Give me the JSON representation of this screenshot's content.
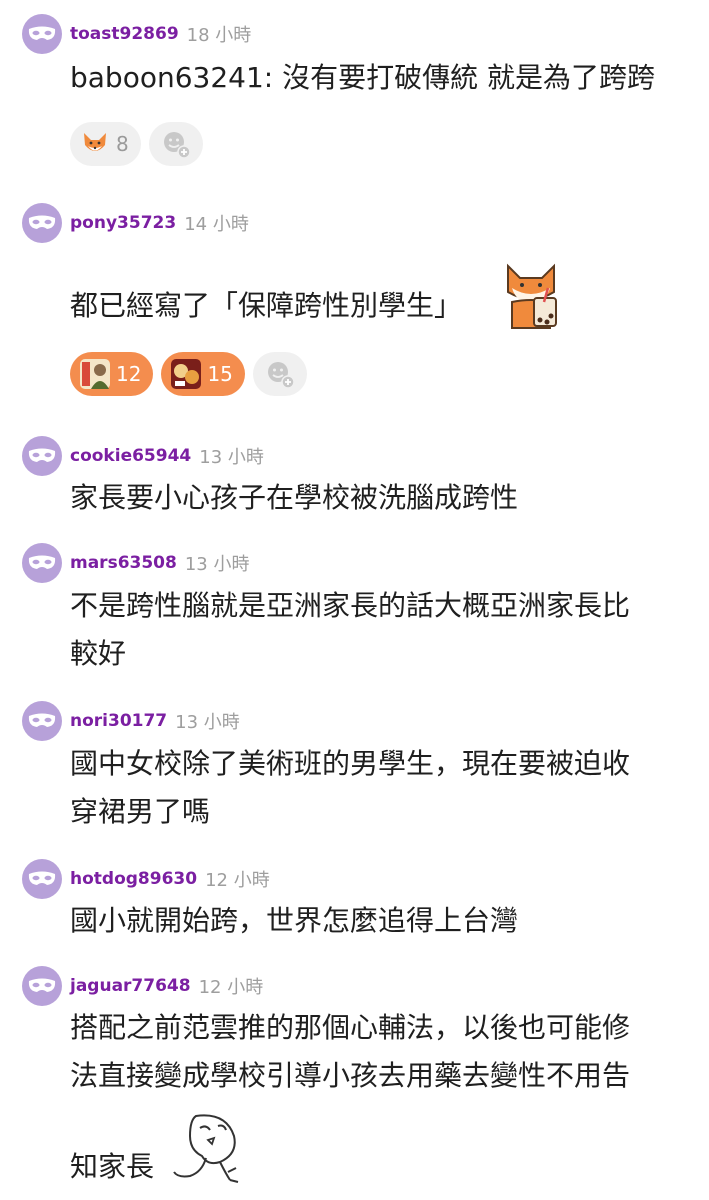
{
  "comments": [
    {
      "username": "toast92869",
      "time": "18 小時",
      "text_lines": [
        "baboon63241: 沒有要打破傳統 就是為了跨跨"
      ],
      "reactions": [
        {
          "icon": "fox-emoji-icon",
          "count": "8",
          "style": "grey"
        }
      ]
    },
    {
      "username": "pony35723",
      "time": "14 小時",
      "text_lines": [
        "都已經寫了「保障跨性別學生」"
      ],
      "sticker": "fox-drinking-bubble-tea-sticker",
      "reactions": [
        {
          "icon": "portrait-sticker-icon",
          "count": "12",
          "style": "orange"
        },
        {
          "icon": "food-sticker-icon",
          "count": "15",
          "style": "orange"
        }
      ]
    },
    {
      "username": "cookie65944",
      "time": "13 小時",
      "text_lines": [
        "家長要小心孩子在學校被洗腦成跨性"
      ]
    },
    {
      "username": "mars63508",
      "time": "13 小時",
      "text_lines": [
        "不是跨性腦就是亞洲家長的話大概亞洲家長比",
        "較好"
      ]
    },
    {
      "username": "nori30177",
      "time": "13 小時",
      "text_lines": [
        "國中女校除了美術班的男學生，現在要被迫收",
        "穿裙男了嗎"
      ]
    },
    {
      "username": "hotdog89630",
      "time": "12 小時",
      "text_lines": [
        "國小就開始跨，世界怎麼追得上台灣"
      ]
    },
    {
      "username": "jaguar77648",
      "time": "12 小時",
      "text_lines": [
        "搭配之前范雲推的那個心輔法，以後也可能修",
        "法直接變成學校引導小孩去用藥去變性不用告",
        "知家長"
      ],
      "sticker": "alien-doodle-sticker"
    }
  ],
  "colors": {
    "avatar_bg": "#b7a1d9",
    "username": "#7b1fa2",
    "time": "#9e9e9e",
    "reaction_orange": "#f48d4e",
    "reaction_grey": "#f0f0f0"
  }
}
